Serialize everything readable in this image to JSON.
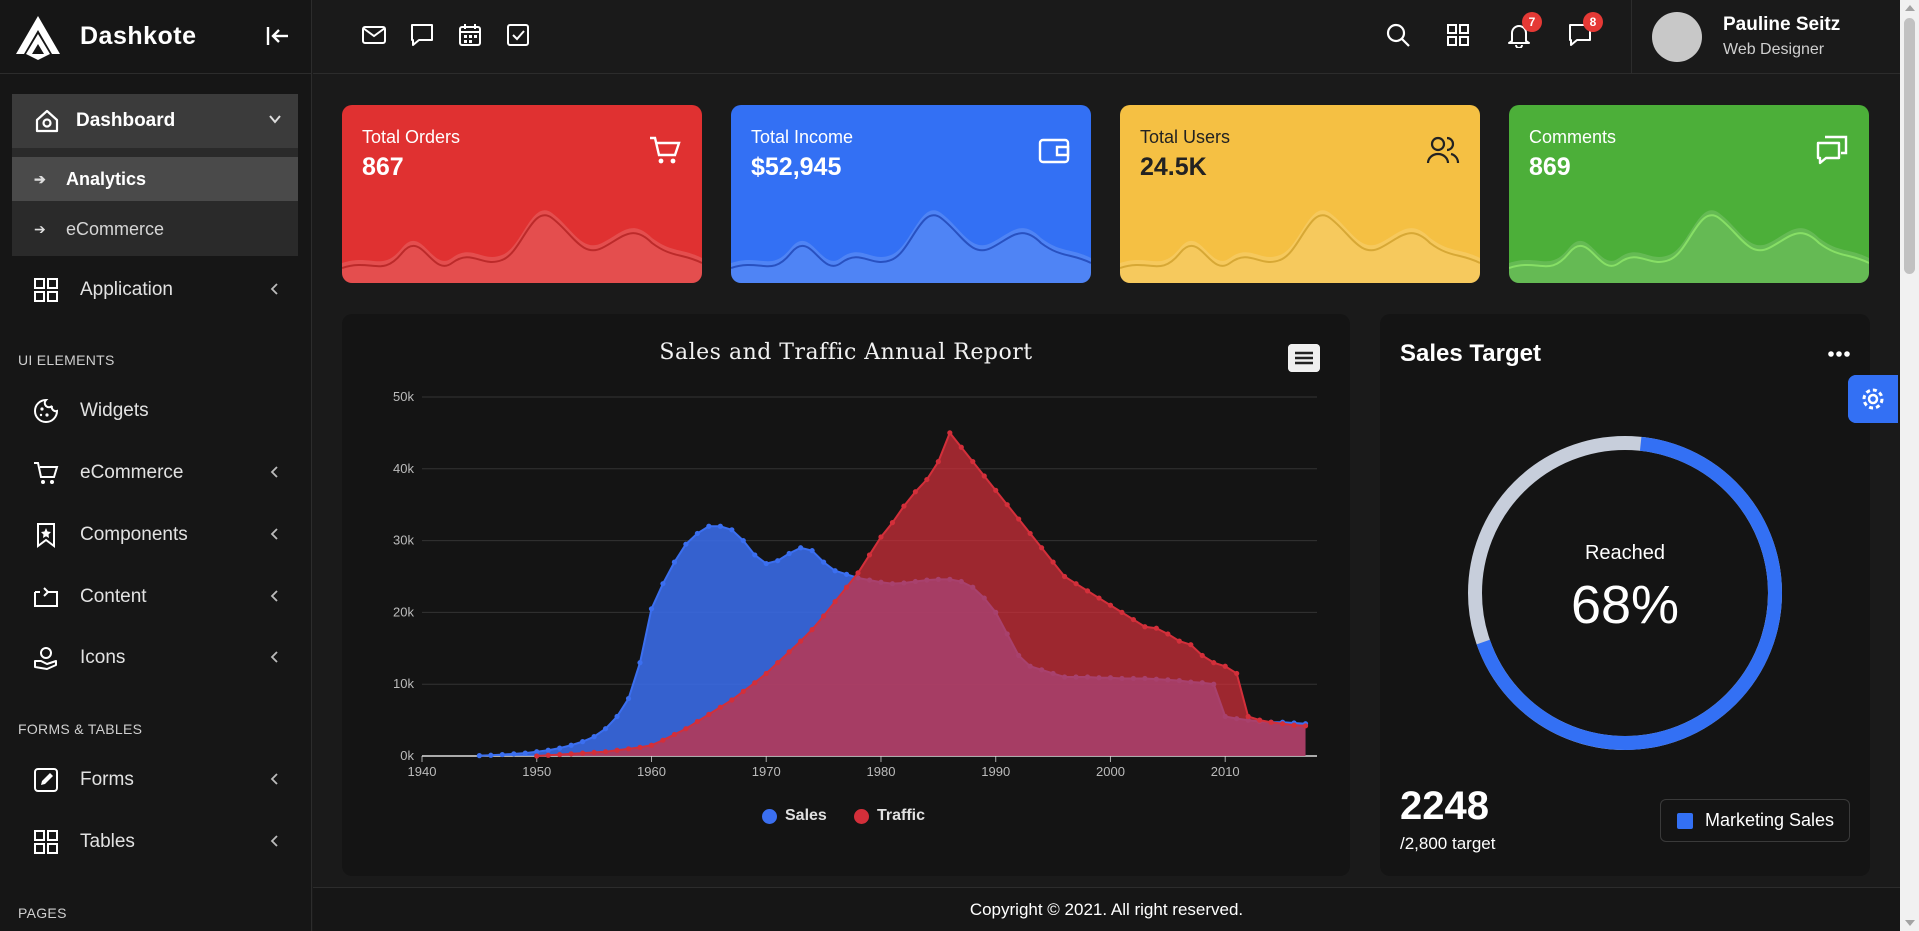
{
  "app": {
    "name": "Dashkote"
  },
  "sidebar": {
    "dashboard": {
      "label": "Dashboard",
      "icon": "home-icon"
    },
    "sub_items": [
      {
        "label": "Analytics",
        "active": true
      },
      {
        "label": "eCommerce",
        "active": false
      }
    ],
    "application": {
      "label": "Application",
      "icon": "grid-icon"
    },
    "sections": {
      "ui": "UI ELEMENTS",
      "forms": "FORMS & TABLES",
      "pages": "PAGES"
    },
    "items": [
      {
        "label": "Widgets",
        "icon": "cookie-icon",
        "expandable": false
      },
      {
        "label": "eCommerce",
        "icon": "cart-icon",
        "expandable": true
      },
      {
        "label": "Components",
        "icon": "bookmark-icon",
        "expandable": true
      },
      {
        "label": "Content",
        "icon": "repeat-icon",
        "expandable": true
      },
      {
        "label": "Icons",
        "icon": "hand-icon",
        "expandable": true
      },
      {
        "label": "Forms",
        "icon": "pencil-square-icon",
        "expandable": true
      },
      {
        "label": "Tables",
        "icon": "table-icon",
        "expandable": true
      }
    ]
  },
  "topbar": {
    "notification_count": "7",
    "message_count": "8",
    "user": {
      "name": "Pauline Seitz",
      "role": "Web Designer"
    }
  },
  "cards": [
    {
      "title": "Total Orders",
      "value": "867",
      "color": "#e03131",
      "icon": "cart-icon"
    },
    {
      "title": "Total Income",
      "value": "$52,945",
      "color": "#3370f4",
      "icon": "wallet-icon"
    },
    {
      "title": "Total Users",
      "value": "24.5K",
      "color": "#f5c043",
      "icon": "users-icon"
    },
    {
      "title": "Comments",
      "value": "869",
      "color": "#4caf39",
      "icon": "chat-icon"
    }
  ],
  "chart_data": {
    "type": "area",
    "title": "Sales and Traffic Annual Report",
    "xlim": [
      1940,
      2018
    ],
    "ylim": [
      0,
      50000
    ],
    "x_ticks": [
      "1940",
      "1950",
      "1960",
      "1970",
      "1980",
      "1990",
      "2000",
      "2010"
    ],
    "y_ticks": [
      "0k",
      "10k",
      "20k",
      "30k",
      "40k",
      "50k"
    ],
    "grid": true,
    "legend_position": "bottom",
    "series": [
      {
        "name": "Sales",
        "color": "#3b6ff0",
        "x": [
          1945,
          1946,
          1947,
          1948,
          1949,
          1950,
          1951,
          1952,
          1953,
          1954,
          1955,
          1956,
          1957,
          1958,
          1959,
          1960,
          1961,
          1962,
          1963,
          1964,
          1965,
          1966,
          1967,
          1968,
          1969,
          1970,
          1971,
          1972,
          1973,
          1974,
          1975,
          1976,
          1977,
          1978,
          1979,
          1980,
          1981,
          1982,
          1983,
          1984,
          1985,
          1986,
          1987,
          1988,
          1989,
          1990,
          1991,
          1992,
          1993,
          1994,
          1995,
          1996,
          1997,
          1998,
          1999,
          2000,
          2001,
          2002,
          2003,
          2004,
          2005,
          2006,
          2007,
          2008,
          2009,
          2010,
          2011,
          2012,
          2013,
          2014,
          2015,
          2016,
          2017
        ],
        "values": [
          50,
          100,
          200,
          300,
          400,
          600,
          800,
          1100,
          1500,
          2000,
          2700,
          3800,
          5500,
          8000,
          13000,
          20500,
          24000,
          27000,
          29500,
          31000,
          32000,
          32000,
          31500,
          30000,
          28000,
          26800,
          27200,
          28200,
          29000,
          28600,
          27000,
          25800,
          25300,
          24800,
          24500,
          24200,
          24000,
          24100,
          24300,
          24500,
          24600,
          24600,
          24300,
          23500,
          22000,
          20000,
          17000,
          14000,
          12500,
          12000,
          11500,
          11000,
          11000,
          11000,
          10900,
          10900,
          10800,
          10800,
          10800,
          10700,
          10600,
          10500,
          10300,
          10200,
          10000,
          5500,
          5200,
          5000,
          4800,
          4700,
          4700,
          4600,
          4500
        ]
      },
      {
        "name": "Traffic",
        "color": "#d32f3a",
        "x": [
          1950,
          1951,
          1952,
          1953,
          1954,
          1955,
          1956,
          1957,
          1958,
          1959,
          1960,
          1961,
          1962,
          1963,
          1964,
          1965,
          1966,
          1967,
          1968,
          1969,
          1970,
          1971,
          1972,
          1973,
          1974,
          1975,
          1976,
          1977,
          1978,
          1979,
          1980,
          1981,
          1982,
          1983,
          1984,
          1985,
          1986,
          1987,
          1988,
          1989,
          1990,
          1991,
          1992,
          1993,
          1994,
          1995,
          1996,
          1997,
          1998,
          1999,
          2000,
          2001,
          2002,
          2003,
          2004,
          2005,
          2006,
          2007,
          2008,
          2009,
          2010,
          2011,
          2012,
          2013,
          2014,
          2015,
          2016,
          2017
        ],
        "values": [
          0,
          100,
          200,
          300,
          400,
          500,
          600,
          800,
          1000,
          1200,
          1500,
          2200,
          3000,
          3800,
          4800,
          5800,
          6800,
          7800,
          9000,
          10200,
          11500,
          13000,
          14500,
          16000,
          17600,
          19500,
          21500,
          23500,
          25500,
          28000,
          30500,
          32500,
          34800,
          36800,
          38500,
          41000,
          45000,
          43000,
          41000,
          39000,
          37000,
          35000,
          33000,
          31000,
          29000,
          27000,
          25000,
          24000,
          23000,
          22000,
          21000,
          20000,
          19000,
          18000,
          17800,
          17000,
          16000,
          15500,
          14000,
          13000,
          12500,
          11500,
          5500,
          5000,
          4700,
          4500,
          4300,
          4200
        ]
      }
    ]
  },
  "sales_target": {
    "title": "Sales Target",
    "reached_label": "Reached",
    "percent_label": "68%",
    "percent": 0.68,
    "value": "2248",
    "target_label": "/2,800 target",
    "legend_label": "Marketing Sales"
  },
  "footer": {
    "text": "Copyright © 2021. All right reserved."
  }
}
